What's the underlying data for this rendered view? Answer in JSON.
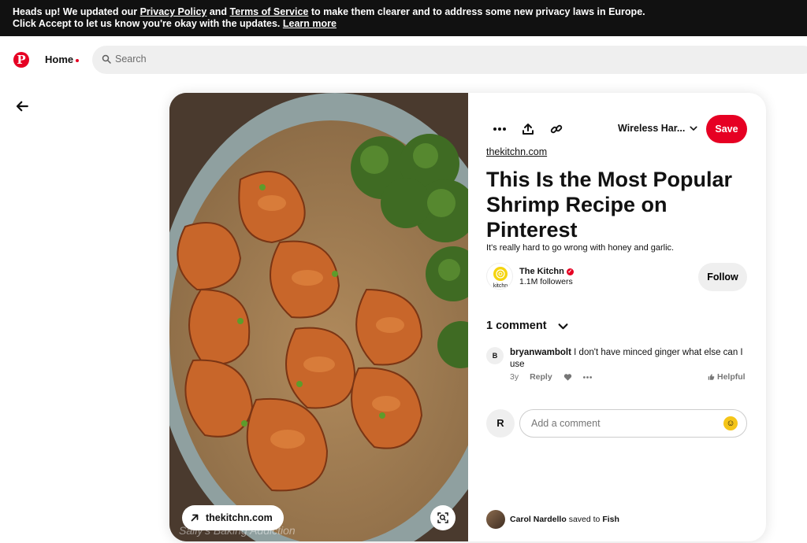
{
  "banner": {
    "part1": "Heads up! We updated our ",
    "privacy_link": "Privacy Policy",
    "part2": " and ",
    "terms_link": "Terms of Service",
    "part3": " to make them clearer and to address some new privacy laws in Europe.",
    "line2": "Click Accept to let us know you're okay with the updates. ",
    "learn_more": "Learn more"
  },
  "header": {
    "logo_letter": "P",
    "home_label": "Home",
    "search_placeholder": "Search"
  },
  "pin": {
    "source_pill": "thekitchn.com",
    "watermark": "Sally's Baking Addiction",
    "board_name": "Wireless Har...",
    "save_label": "Save",
    "domain": "thekitchn.com",
    "title": "This Is the Most Popular Shrimp Recipe on Pinterest",
    "description": "It's really hard to go wrong with honey and garlic.",
    "profile": {
      "logo_text": "kitchn",
      "name": "The Kitchn",
      "followers": "1.1M followers",
      "follow_label": "Follow"
    },
    "comments": {
      "header": "1 comment",
      "items": [
        {
          "avatar_letter": "B",
          "user": "bryanwambolt",
          "text": "I don't have minced ginger what else can I use",
          "age": "3y",
          "reply_label": "Reply",
          "helpful_label": "Helpful"
        }
      ],
      "my_avatar_letter": "R",
      "add_placeholder": "Add a comment"
    },
    "saved_by": {
      "name": "Carol Nardello",
      "saved_to_text": "saved to",
      "board": "Fish"
    }
  },
  "colors": {
    "brand_red": "#e60023",
    "banner_bg": "#111111",
    "pill_gray": "#efefef"
  }
}
